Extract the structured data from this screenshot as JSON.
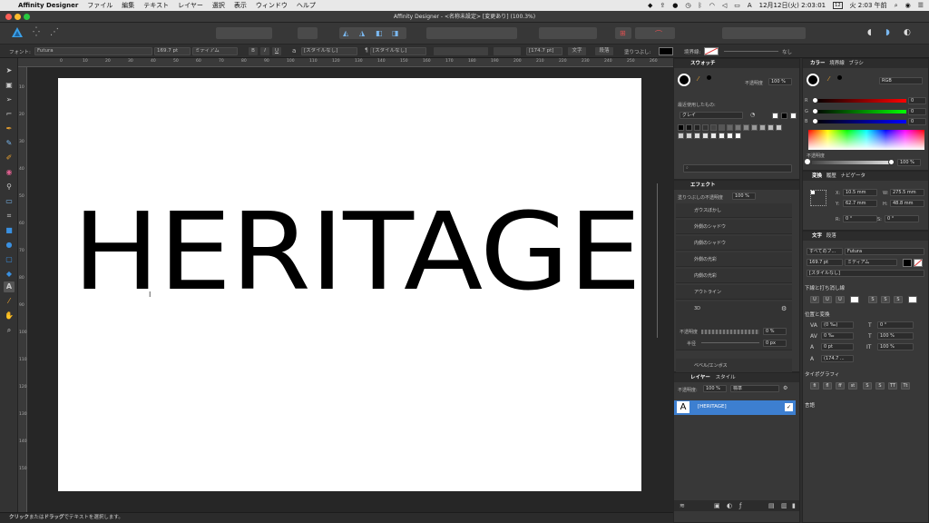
{
  "menubar": {
    "app": "Affinity Designer",
    "items": [
      "ファイル",
      "編集",
      "テキスト",
      "レイヤー",
      "選択",
      "表示",
      "ウィンドウ",
      "ヘルプ"
    ],
    "status_a": "A",
    "datetime": "12月12日(火) 2:03:01",
    "datetime2": "火 2:03 午前",
    "calendar_day": "12"
  },
  "window": {
    "title": "Affinity Designer - <名称未設定> [変更あり] (100.3%)"
  },
  "context": {
    "font_label": "フォント:",
    "font": "Futura",
    "size": "169.7 pt",
    "weight": "ミディアム",
    "bold": "B",
    "italic": "I",
    "underline": "U",
    "char_style_a": "[スタイルなし]",
    "para_mark": "¶",
    "char_style_b": "[スタイルなし]",
    "tracking": "[174.7 pt]",
    "char_btn": "文字",
    "para_btn": "段落",
    "fill_label": "塗りつぶし:",
    "stroke_label": "境界線:",
    "stroke_none": "なし"
  },
  "canvas": {
    "text": "HERITAGE",
    "ruler_ticks": [
      "0",
      "10",
      "20",
      "30",
      "40",
      "50",
      "60",
      "70",
      "80",
      "90",
      "100",
      "110",
      "120",
      "130",
      "140",
      "150",
      "160",
      "170",
      "180",
      "190",
      "200",
      "210",
      "220",
      "230",
      "240",
      "250",
      "260"
    ],
    "vruler_ticks": [
      "10",
      "20",
      "30",
      "40",
      "50",
      "60",
      "70",
      "80",
      "90",
      "100",
      "110",
      "120",
      "130",
      "140",
      "150"
    ]
  },
  "statusbar": {
    "click": "クリック",
    "mid": "または",
    "drag": "ドラッグ",
    "rest": "でテキストを選択します。"
  },
  "swatches": {
    "title": "スウォッチ",
    "opacity_label": "不透明度",
    "opacity": "100 %",
    "recent": "最近使用したもの:",
    "palette": "グレイ"
  },
  "effects": {
    "title": "エフェクト",
    "fill_opacity_label": "塗りつぶしの不透明度",
    "fill_opacity": "100 %",
    "items": [
      "ガウスぼかし",
      "外側のシャドウ",
      "内側のシャドウ",
      "外側の光彩",
      "内側の光彩",
      "アウトライン",
      "3D"
    ],
    "opacity_label": "不透明度",
    "opacity": "0 %",
    "radius_label": "半径",
    "radius": "0 px",
    "last": "ベベル/エンボス"
  },
  "layers": {
    "tab_layers": "レイヤー",
    "tab_styles": "スタイル",
    "opacity_label": "不透明度:",
    "opacity": "100 %",
    "blend": "標準",
    "item": "[HERITAGE]"
  },
  "color": {
    "tab_color": "カラー",
    "tab_stroke": "境界線",
    "tab_brush": "ブラシ",
    "model": "RGB",
    "r_label": "R",
    "g_label": "G",
    "b_label": "B",
    "r": "0",
    "g": "0",
    "b": "0",
    "opacity_label": "不透明度",
    "opacity": "100 %"
  },
  "transform": {
    "tab_transform": "変換",
    "tab_history": "履歴",
    "tab_navigator": "ナビゲータ",
    "x_label": "X:",
    "x": "10.5 mm",
    "w_label": "W:",
    "w": "275.5 mm",
    "y_label": "Y:",
    "y": "62.7 mm",
    "h_label": "H:",
    "h": "48.8 mm",
    "r_label": "R:",
    "r": "0 °",
    "s_label": "S:",
    "s": "0 °"
  },
  "text_panel": {
    "tab_text": "文字",
    "tab_para": "段落",
    "family_label": "すべてのフ...",
    "family": "Futura",
    "size": "169.7 pt",
    "weight": "ミディアム",
    "style": "[スタイルなし]",
    "underline_section": "下線と打ち消し線",
    "position_section": "位置と変換",
    "kern": "(0 ‰)",
    "angle": "0 °",
    "track": "0 ‰",
    "scale_v": "100 %",
    "baseline": "0 pt",
    "scale_h": "100 %",
    "leading": "(174.7 ...",
    "typo_section": "タイポグラフィ",
    "lang_section": "言語"
  }
}
